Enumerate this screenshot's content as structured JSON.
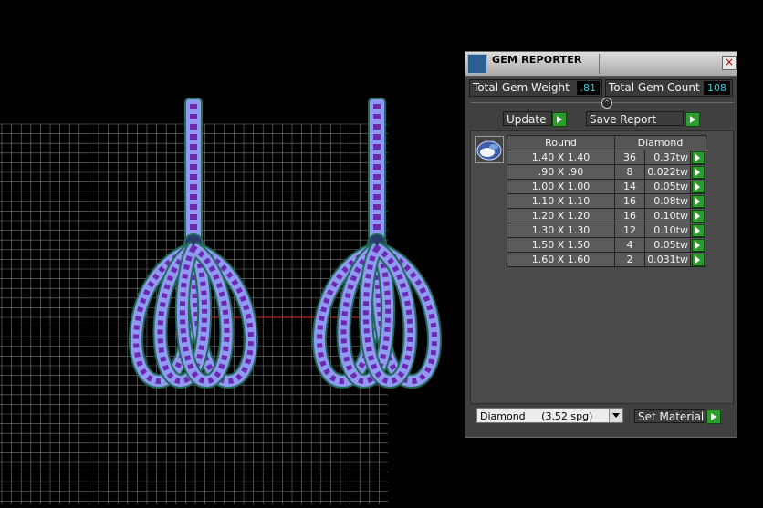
{
  "colors": {
    "background": "#000000",
    "grid": "#7a7a7a",
    "gem_light": "#8f9af0",
    "gem_dark": "#6a2ab0",
    "wire": "#1f6b5a",
    "axis_red": "#b42020",
    "panel": "#404040",
    "value_text": "#35d0d8",
    "arrow_green": "#2d9b2d"
  },
  "panel": {
    "title": "GEM REPORTER",
    "close_label": "×",
    "total_weight_label": "Total Gem Weight",
    "total_weight_value": ".81",
    "total_count_label": "Total Gem Count",
    "total_count_value": "108",
    "update_label": "Update",
    "save_report_label": "Save Report",
    "table": {
      "headers": [
        "Round",
        "Diamond"
      ],
      "rows": [
        {
          "size": "1.40 X 1.40",
          "count": "36",
          "weight": "0.37tw"
        },
        {
          "size": ".90 X .90",
          "count": "8",
          "weight": "0.022tw"
        },
        {
          "size": "1.00 X 1.00",
          "count": "14",
          "weight": "0.05tw"
        },
        {
          "size": "1.10 X 1.10",
          "count": "16",
          "weight": "0.08tw"
        },
        {
          "size": "1.20 X 1.20",
          "count": "16",
          "weight": "0.10tw"
        },
        {
          "size": "1.30 X 1.30",
          "count": "12",
          "weight": "0.10tw"
        },
        {
          "size": "1.50 X 1.50",
          "count": "4",
          "weight": "0.05tw"
        },
        {
          "size": "1.60 X 1.60",
          "count": "2",
          "weight": "0.031tw"
        }
      ]
    },
    "material_select_value": "Diamond     (3.52 spg)",
    "set_material_label": "Set Material"
  }
}
